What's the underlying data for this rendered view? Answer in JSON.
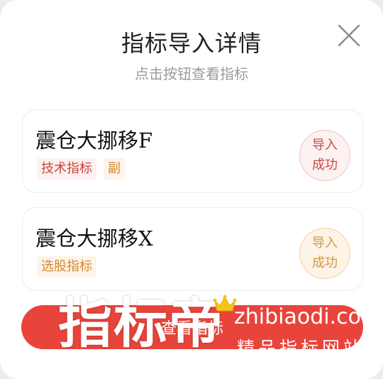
{
  "dialog": {
    "title": "指标导入详情",
    "subtitle": "点击按钮查看指标",
    "close_icon": "close-icon"
  },
  "cards": [
    {
      "name": "震仓大挪移F",
      "tags": [
        "技术指标",
        "副"
      ],
      "status_line1": "导入",
      "status_line2": "成功",
      "accent": "#c9443a"
    },
    {
      "name": "震仓大挪移X",
      "tags": [
        "选股指标"
      ],
      "status_line1": "导入",
      "status_line2": "成功",
      "accent": "#d28b2c"
    }
  ],
  "button": {
    "label": "查看指标",
    "color": "#e8443b"
  },
  "watermark": {
    "logo_text": "指标帝",
    "url": "zhibiaodi.com",
    "slogan": "精品指标网站",
    "crown_icon": "crown-icon"
  }
}
